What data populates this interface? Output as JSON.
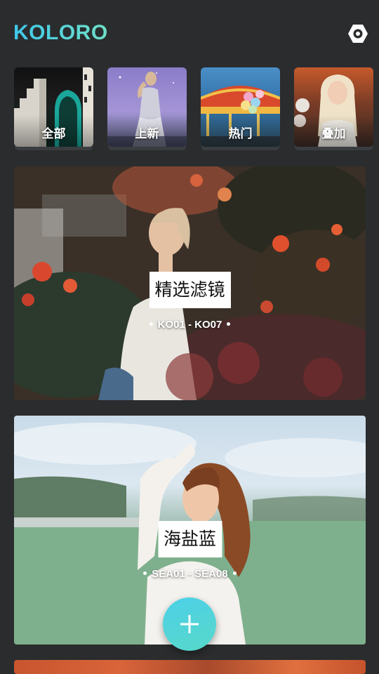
{
  "app": {
    "logo": "KOLORO",
    "settings_icon": "gear-icon"
  },
  "categories": [
    {
      "label": "全部",
      "theme": "architecture-arch"
    },
    {
      "label": "上新",
      "theme": "woman-purple-sky"
    },
    {
      "label": "热门",
      "theme": "carousel-balloons"
    },
    {
      "label": "叠加",
      "theme": "blonde-woman-flowers"
    }
  ],
  "collections": [
    {
      "title": "精选滤镜",
      "range": "KO01 - KO07"
    },
    {
      "title": "海盐蓝",
      "range": "SEA01 - SEA08"
    }
  ],
  "fab": {
    "icon": "plus-icon"
  },
  "colors": {
    "background": "#2a2c2e",
    "accent_start": "#3ec8ea",
    "accent_end": "#6fe0c7"
  }
}
